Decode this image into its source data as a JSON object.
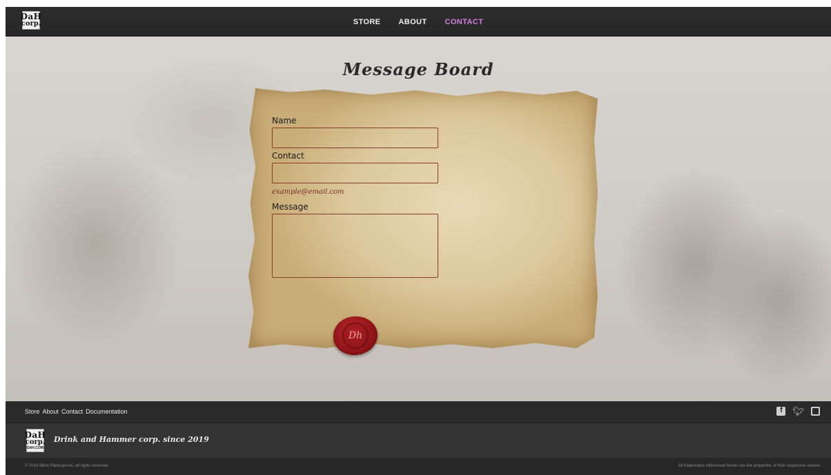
{
  "logo": {
    "line1": "DaH",
    "line2": "corp.",
    "sub": "DAH.COM"
  },
  "nav": {
    "items": [
      {
        "label": "STORE",
        "active": false
      },
      {
        "label": "ABOUT",
        "active": false
      },
      {
        "label": "CONTACT",
        "active": true
      }
    ]
  },
  "main": {
    "title": "Message Board",
    "form": {
      "name_label": "Name",
      "contact_label": "Contact",
      "contact_hint": "example@email.com",
      "message_label": "Message",
      "seal_text": "Dh"
    }
  },
  "footer": {
    "links": [
      "Store",
      "About",
      "Contact",
      "Documentation"
    ],
    "social": [
      "facebook-icon",
      "twitter-icon",
      "twitch-icon"
    ],
    "tagline": "Drink and Hammer corp. since 2019",
    "copyright": "© 2019 Miloš Parezanović, all rights reserved.",
    "trademark": "All trademarks referenced herein are the properties of their respective owners."
  },
  "colors": {
    "nav_active": "#d480e0",
    "seal": "#8e1418",
    "hint": "#7a2a22"
  }
}
